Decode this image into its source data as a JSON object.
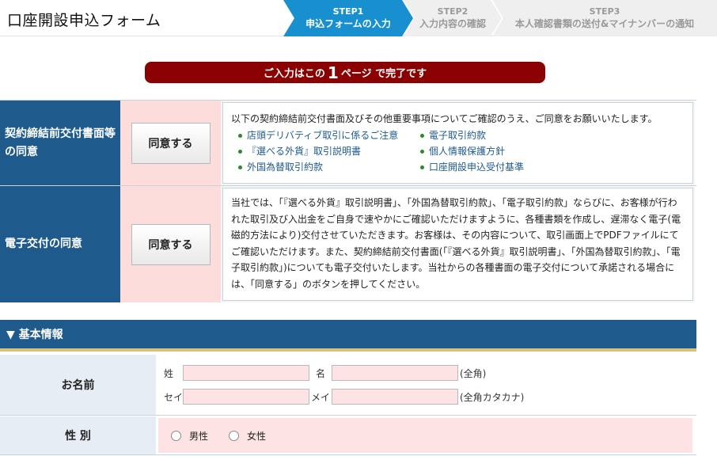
{
  "header": {
    "title": "口座開設申込フォーム",
    "steps": [
      {
        "num": "STEP1",
        "label": "申込フォームの入力"
      },
      {
        "num": "STEP2",
        "label": "入力内容の確認"
      },
      {
        "num": "STEP3",
        "label": "本人確認書類の送付&マイナンバーの通知"
      }
    ]
  },
  "banner": {
    "pre": "ご入力はこの",
    "big": "1",
    "post": "ページ で完了です"
  },
  "consents": [
    {
      "label": "契約締結前交付書面等の同意",
      "button": "同意する",
      "intro": "以下の契約締結前交付書面及びその他重要事項についてご確認のうえ、ご同意をお願いいたします。",
      "docs": [
        "店頭デリバティブ取引に係るご注意",
        "電子取引約款",
        "『選べる外貨』取引説明書",
        "個人情報保護方針",
        "外国為替取引約款",
        "口座開設申込受付基準"
      ]
    },
    {
      "label": "電子交付の同意",
      "button": "同意する",
      "text": "当社では、「『選べる外貨』取引説明書」、「外国為替取引約款」、「電子取引約款」ならびに、お客様が行われた取引及び入出金をご自身で速やかにご確認いただけますように、各種書類を作成し、遅滞なく電子(電磁的方法により)交付させていただきます。お客様は、その内容について、取引画面上でPDFファイルにてご確認いただけます。また、契約締結前交付書面(「『選べる外貨』取引説明書」、「外国為替取引約款」、「電子取引約款」)についても電子交付いたします。当社からの各種書面の電子交付について承諾される場合には、「同意する」のボタンを押してください。"
    }
  ],
  "basic": {
    "header": "▼ 基本情報",
    "name_label": "お名前",
    "sei_label": "姓",
    "mei_label": "名",
    "zenkaku": "(全角)",
    "sei_kana_label": "セイ",
    "mei_kana_label": "メイ",
    "zenkaku_kana": "(全角カタカナ)",
    "gender_label": "性 別",
    "male": "男性",
    "female": "女性"
  },
  "colors": {
    "navy": "#1f5a8c",
    "step_active": "#1890cf",
    "banner": "#8b0000",
    "pink": "#fde3e3"
  }
}
